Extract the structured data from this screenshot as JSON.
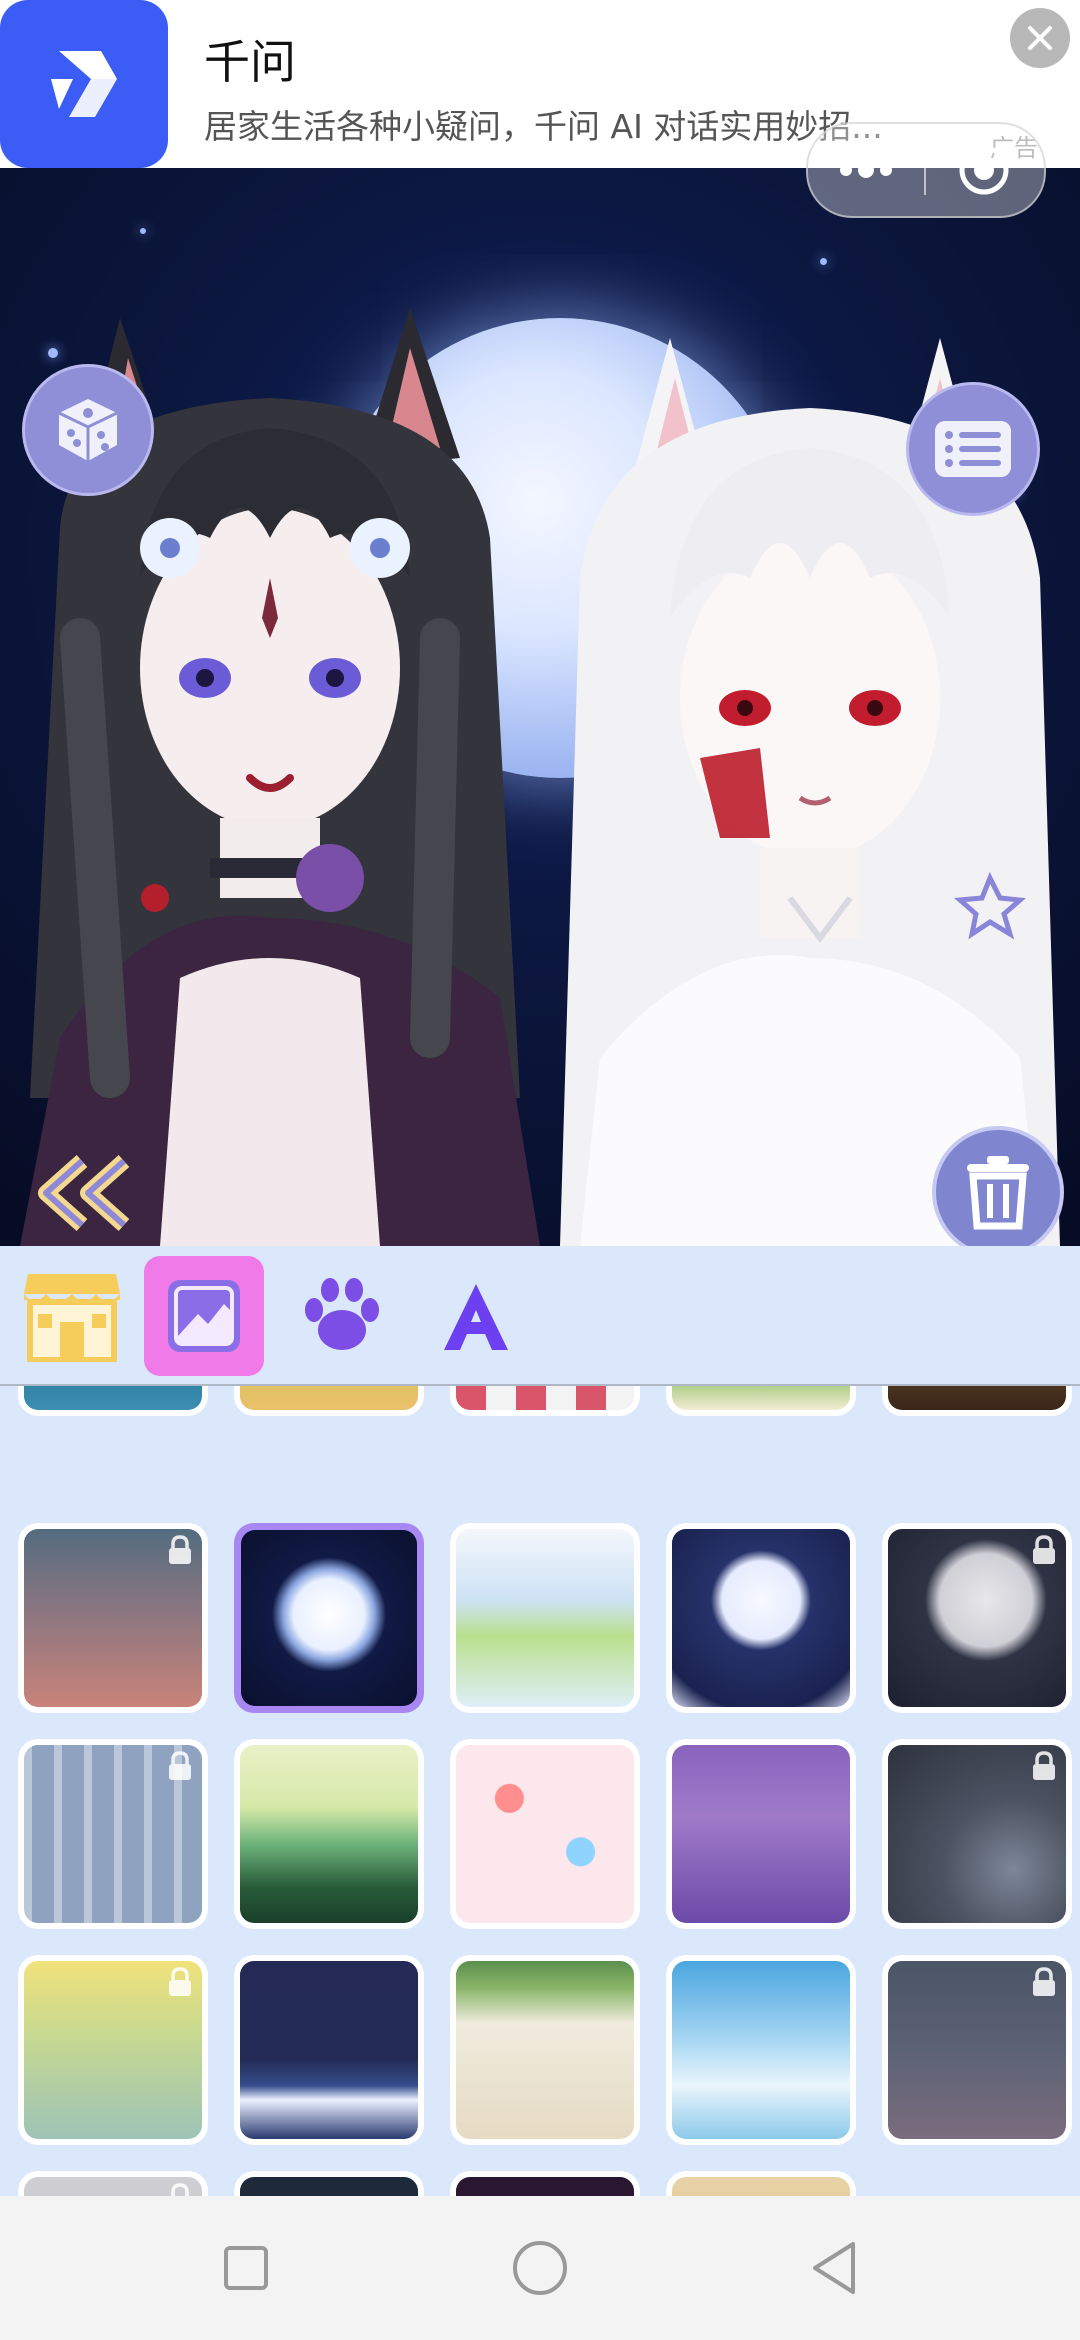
{
  "ad": {
    "title": "千问",
    "description": "居家生活各种小疑问，千问 AI 对话实用妙招...",
    "tag": "广告"
  },
  "toolbar": {
    "tabs": [
      {
        "name": "shop",
        "icon": "shop-icon",
        "selected": false
      },
      {
        "name": "background",
        "icon": "background-image-icon",
        "selected": true
      },
      {
        "name": "pet",
        "icon": "paw-icon",
        "selected": false
      },
      {
        "name": "text",
        "icon": "letter-a-icon",
        "selected": false
      }
    ]
  },
  "colors": {
    "accent": "#f07be8",
    "selected_border": "#a887f2",
    "button_purple": "#8e8fd6",
    "panel_bg": "#dbe8fb"
  },
  "backgrounds": [
    {
      "name": "sea-sunset",
      "locked": false,
      "selected": false
    },
    {
      "name": "autumn-tree",
      "locked": false,
      "selected": false
    },
    {
      "name": "checker-pattern",
      "locked": false,
      "selected": false
    },
    {
      "name": "watermelon",
      "locked": false,
      "selected": false
    },
    {
      "name": "wood",
      "locked": false,
      "selected": false
    },
    {
      "name": "pink-dusk",
      "locked": true,
      "selected": false
    },
    {
      "name": "full-moon-night",
      "locked": false,
      "selected": true
    },
    {
      "name": "lily-pond",
      "locked": false,
      "selected": false
    },
    {
      "name": "moon-crystal",
      "locked": false,
      "selected": false
    },
    {
      "name": "grey-moon",
      "locked": true,
      "selected": false
    },
    {
      "name": "birch-forest",
      "locked": true,
      "selected": false
    },
    {
      "name": "green-mountain",
      "locked": false,
      "selected": false
    },
    {
      "name": "pastel-dice",
      "locked": false,
      "selected": false
    },
    {
      "name": "purple-clouds",
      "locked": false,
      "selected": false
    },
    {
      "name": "spider-web",
      "locked": true,
      "selected": false
    },
    {
      "name": "golden-waves",
      "locked": true,
      "selected": false
    },
    {
      "name": "night-ocean",
      "locked": false,
      "selected": false
    },
    {
      "name": "ivy-wall",
      "locked": false,
      "selected": false
    },
    {
      "name": "sky-clouds",
      "locked": false,
      "selected": false
    },
    {
      "name": "crescent-dusk",
      "locked": true,
      "selected": false
    },
    {
      "name": "grey-partial",
      "locked": true,
      "selected": false
    },
    {
      "name": "dark-partial",
      "locked": false,
      "selected": false
    },
    {
      "name": "heart-partial",
      "locked": false,
      "selected": false
    },
    {
      "name": "beige-partial",
      "locked": false,
      "selected": false
    }
  ]
}
